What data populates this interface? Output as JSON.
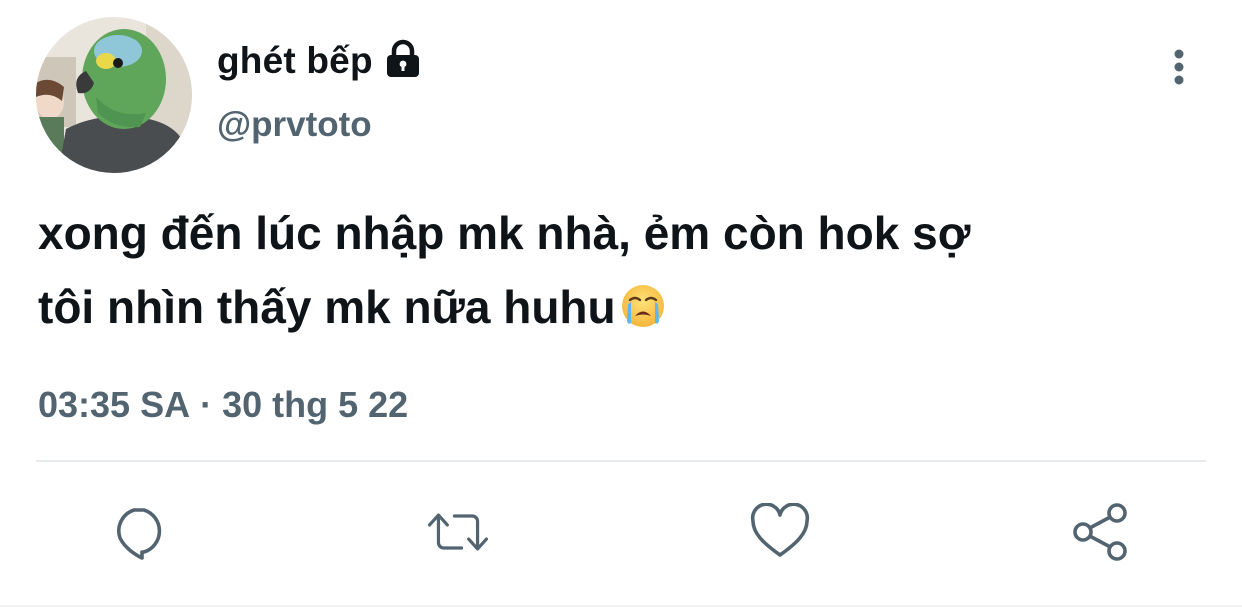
{
  "tweet": {
    "display_name": "ghét bếp",
    "handle": "@prvtoto",
    "text_line_1": "xong đến lúc nhập mk nhà, ẻm còn hok sợ",
    "text_line_2": "tôi nhìn thấy mk nữa huhu",
    "time": "03:35 SA",
    "separator": "·",
    "date": "30 thg 5 22"
  },
  "icons": {
    "protected": "lock-icon",
    "more": "more-vertical-icon",
    "emoji": "loudly-crying-face-emoji",
    "reply": "reply-icon",
    "retweet": "retweet-icon",
    "like": "heart-icon",
    "share": "share-icon"
  },
  "colors": {
    "text_primary": "#0f1419",
    "text_secondary": "#536471",
    "icon": "#536471",
    "divider": "#e8ebed"
  }
}
